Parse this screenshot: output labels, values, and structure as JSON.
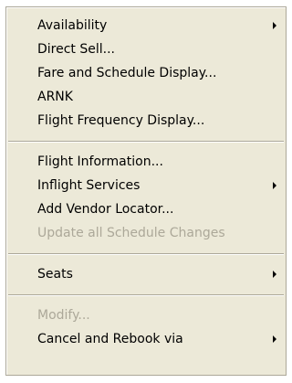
{
  "menu": {
    "items": [
      {
        "label": "Availability",
        "submenu": true,
        "enabled": true
      },
      {
        "label": "Direct Sell...",
        "submenu": false,
        "enabled": true
      },
      {
        "label": "Fare and Schedule Display...",
        "submenu": false,
        "enabled": true
      },
      {
        "label": "ARNK",
        "submenu": false,
        "enabled": true
      },
      {
        "label": "Flight Frequency Display...",
        "submenu": false,
        "enabled": true
      },
      {
        "label": "Flight Information...",
        "submenu": false,
        "enabled": true
      },
      {
        "label": "Inflight Services",
        "submenu": true,
        "enabled": true
      },
      {
        "label": "Add Vendor Locator...",
        "submenu": false,
        "enabled": true
      },
      {
        "label": "Update all Schedule Changes",
        "submenu": false,
        "enabled": false
      },
      {
        "label": "Seats",
        "submenu": true,
        "enabled": true
      },
      {
        "label": "Modify...",
        "submenu": false,
        "enabled": false
      },
      {
        "label": "Cancel and Rebook via",
        "submenu": true,
        "enabled": true
      }
    ]
  },
  "colors": {
    "menu_background": "#ece9d8",
    "disabled_text": "#aca899",
    "border": "#aca899"
  }
}
